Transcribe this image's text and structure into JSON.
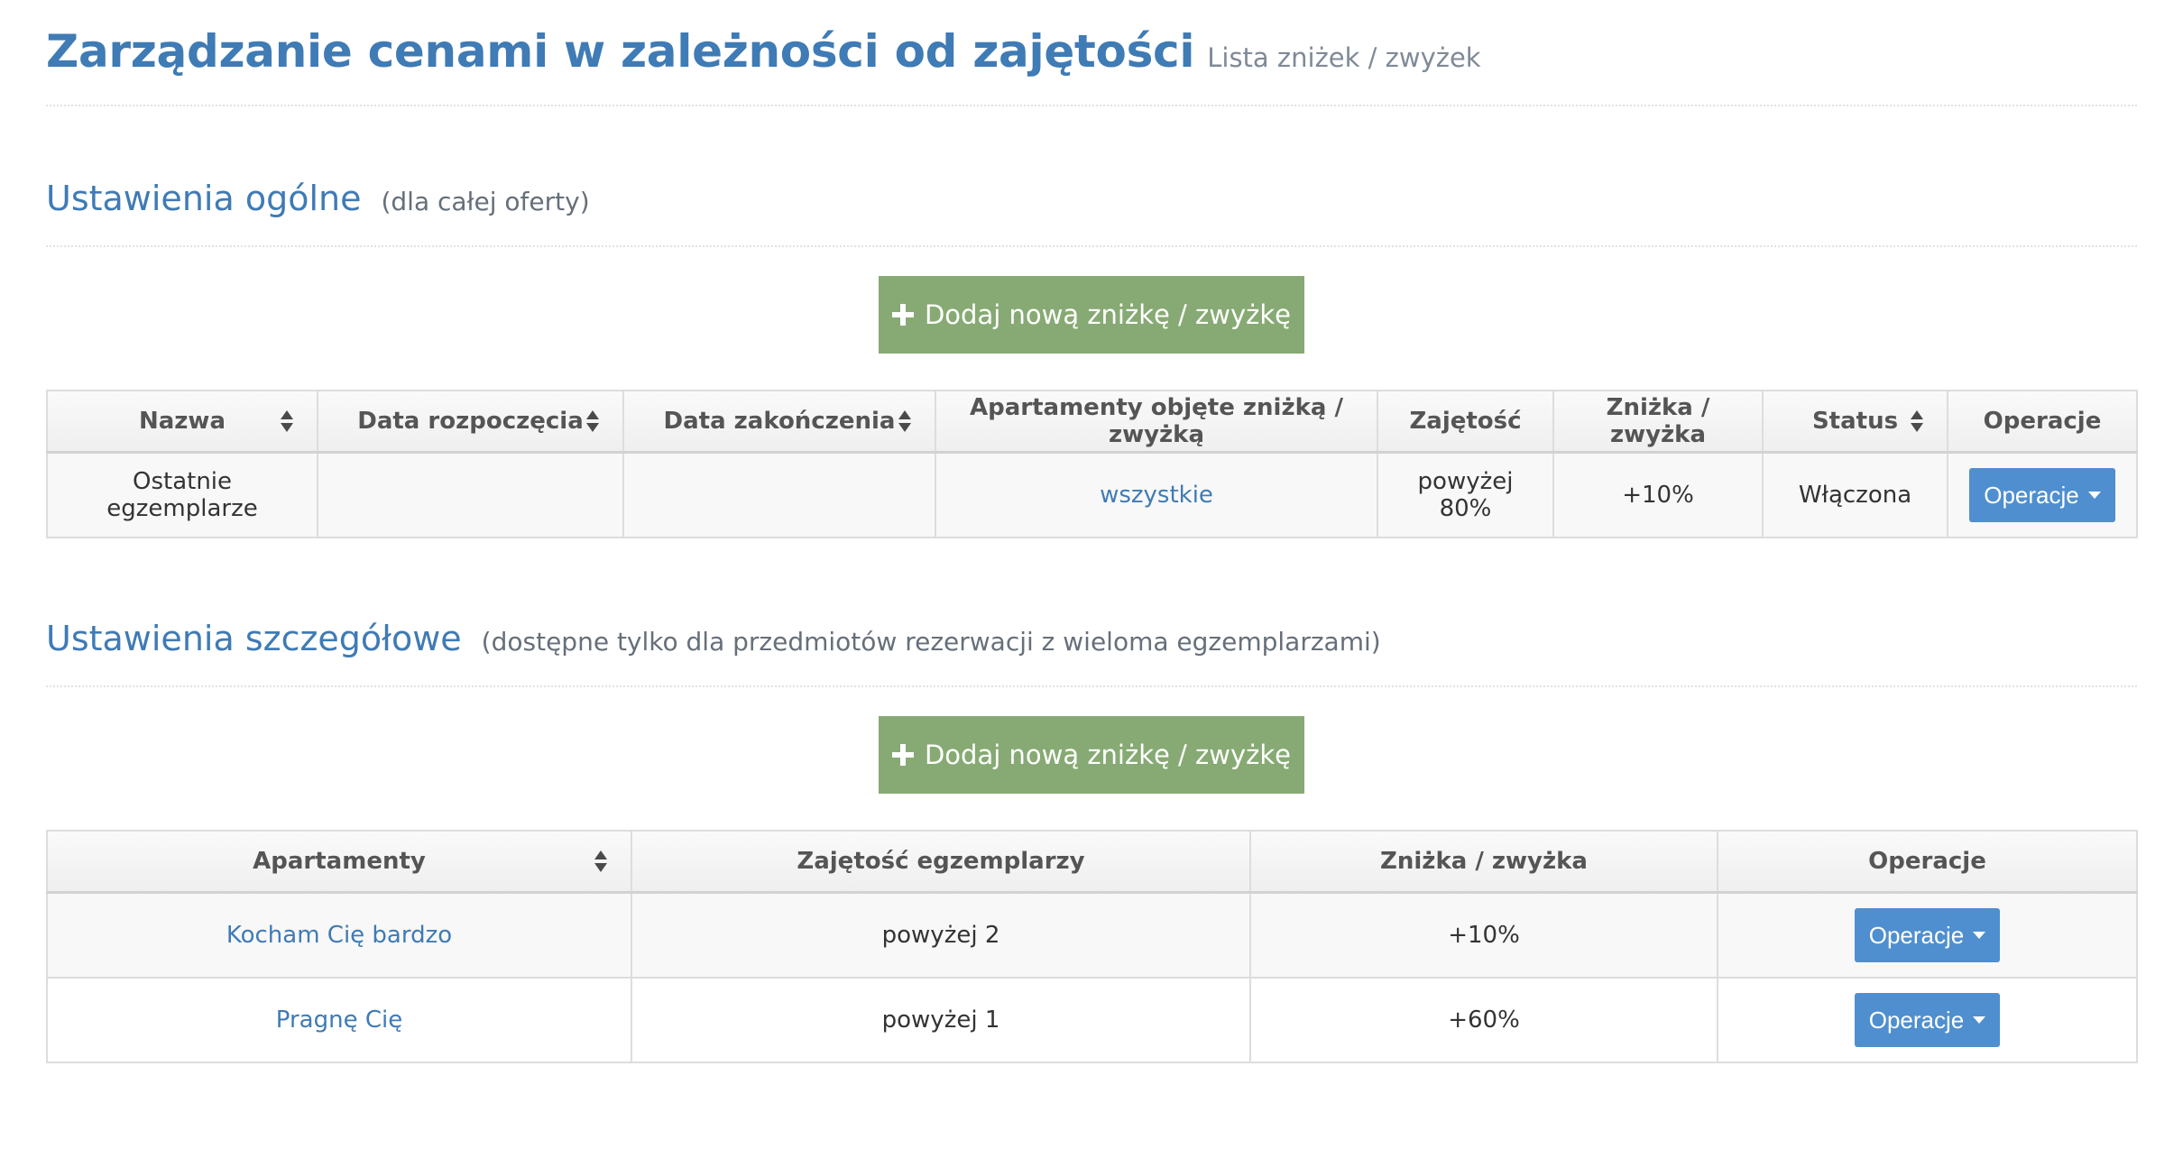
{
  "header": {
    "title": "Zarządzanie cenami w zależności od zajętości",
    "subtitle": "Lista zniżek / zwyżek"
  },
  "general": {
    "title": "Ustawienia ogólne",
    "note": "(dla całej oferty)",
    "add_label": "Dodaj nową zniżkę / zwyżkę",
    "columns": [
      "Nazwa",
      "Data rozpoczęcia",
      "Data zakończenia",
      "Apartamenty objęte zniżką / zwyżką",
      "Zajętość",
      "Zniżka / zwyżka",
      "Status",
      "Operacje"
    ],
    "rows": [
      {
        "name": "Ostatnie egzemplarze",
        "start": "",
        "end": "",
        "apartments": "wszystkie",
        "occupancy": "powyżej 80%",
        "change": "+10%",
        "status": "Włączona",
        "ops_label": "Operacje"
      }
    ]
  },
  "detailed": {
    "title": "Ustawienia szczegółowe",
    "note": "(dostępne tylko dla przedmiotów rezerwacji z wieloma egzemplarzami)",
    "add_label": "Dodaj nową zniżkę / zwyżkę",
    "columns": [
      "Apartamenty",
      "Zajętość egzemplarzy",
      "Zniżka / zwyżka",
      "Operacje"
    ],
    "rows": [
      {
        "apartment": "Kocham Cię bardzo",
        "occupancy": "powyżej 2",
        "change": "+10%",
        "ops_label": "Operacje"
      },
      {
        "apartment": "Pragnę Cię",
        "occupancy": "powyżej 1",
        "change": "+60%",
        "ops_label": "Operacje"
      }
    ]
  },
  "colors": {
    "title_blue": "#3f7bb5",
    "add_green": "#87aa74",
    "ops_blue": "#4f8fcf",
    "status_green": "#7aa75a"
  }
}
